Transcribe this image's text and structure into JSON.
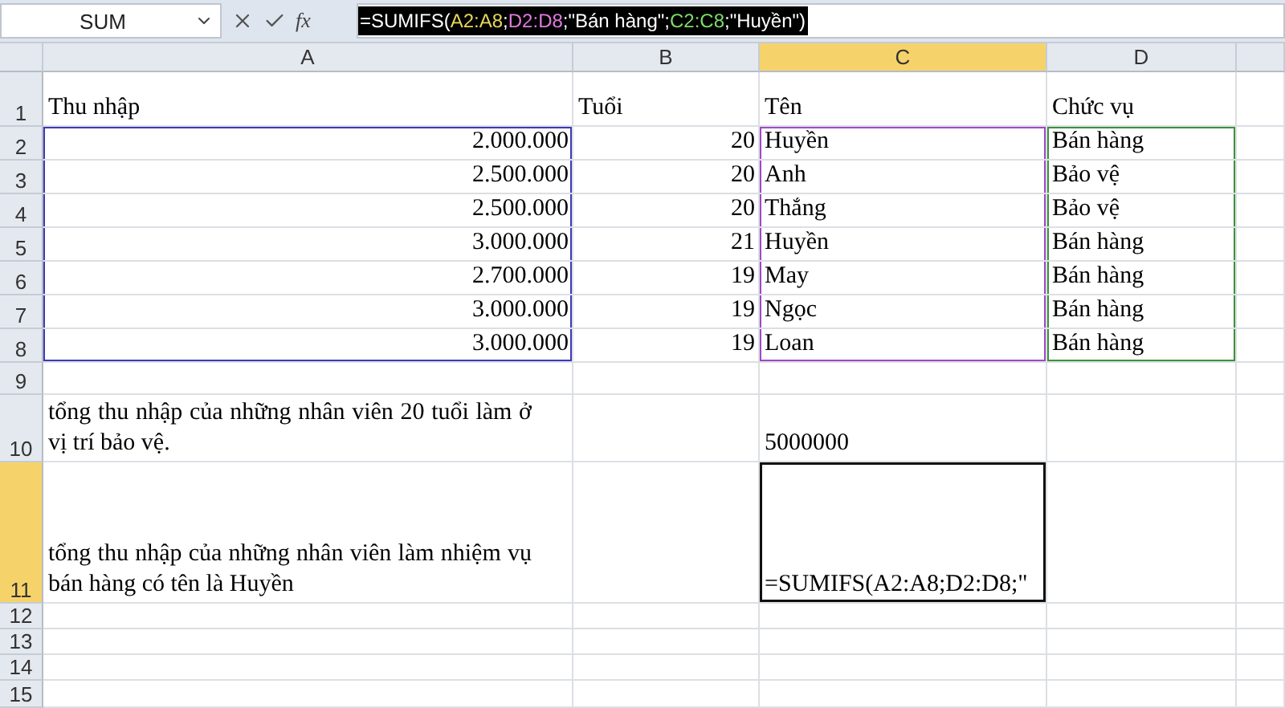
{
  "formula_bar": {
    "name_box": "SUM",
    "function_label": "fx",
    "formula": [
      {
        "text": "=SUMIFS("
      },
      {
        "text": "A2:A8",
        "color": "#e6d75a"
      },
      {
        "text": ";"
      },
      {
        "text": "D2:D8",
        "color": "#e07ae0"
      },
      {
        "text": ";\"Bán hàng\";"
      },
      {
        "text": "C2:C8",
        "color": "#7ddc6a"
      },
      {
        "text": ";\"Huyền\")"
      }
    ]
  },
  "columns": [
    {
      "label": "A",
      "selected": false
    },
    {
      "label": "B",
      "selected": false
    },
    {
      "label": "C",
      "selected": true
    },
    {
      "label": "D",
      "selected": false
    }
  ],
  "rows": [
    {
      "label": "1",
      "selected": false,
      "cells": [
        {
          "text": "Thu nhập",
          "kind": "text"
        },
        {
          "text": "Tuổi",
          "kind": "text"
        },
        {
          "text": "Tên",
          "kind": "text"
        },
        {
          "text": "Chức vụ",
          "kind": "text"
        }
      ]
    },
    {
      "label": "2",
      "selected": false,
      "cells": [
        {
          "text": "2.000.000",
          "kind": "number"
        },
        {
          "text": "20",
          "kind": "number"
        },
        {
          "text": "Huyền",
          "kind": "text"
        },
        {
          "text": "Bán hàng",
          "kind": "text"
        }
      ]
    },
    {
      "label": "3",
      "selected": false,
      "cells": [
        {
          "text": "2.500.000",
          "kind": "number"
        },
        {
          "text": "20",
          "kind": "number"
        },
        {
          "text": "Anh",
          "kind": "text"
        },
        {
          "text": "Bảo vệ",
          "kind": "text"
        }
      ]
    },
    {
      "label": "4",
      "selected": false,
      "cells": [
        {
          "text": "2.500.000",
          "kind": "number"
        },
        {
          "text": "20",
          "kind": "number"
        },
        {
          "text": "Thắng",
          "kind": "text"
        },
        {
          "text": "Bảo vệ",
          "kind": "text"
        }
      ]
    },
    {
      "label": "5",
      "selected": false,
      "cells": [
        {
          "text": "3.000.000",
          "kind": "number"
        },
        {
          "text": "21",
          "kind": "number"
        },
        {
          "text": "Huyền",
          "kind": "text"
        },
        {
          "text": "Bán hàng",
          "kind": "text"
        }
      ]
    },
    {
      "label": "6",
      "selected": false,
      "cells": [
        {
          "text": "2.700.000",
          "kind": "number"
        },
        {
          "text": "19",
          "kind": "number"
        },
        {
          "text": "May",
          "kind": "text"
        },
        {
          "text": "Bán hàng",
          "kind": "text"
        }
      ]
    },
    {
      "label": "7",
      "selected": false,
      "cells": [
        {
          "text": "3.000.000",
          "kind": "number"
        },
        {
          "text": "19",
          "kind": "number"
        },
        {
          "text": "Ngọc",
          "kind": "text"
        },
        {
          "text": "Bán hàng",
          "kind": "text"
        }
      ]
    },
    {
      "label": "8",
      "selected": false,
      "cells": [
        {
          "text": "3.000.000",
          "kind": "number"
        },
        {
          "text": "19",
          "kind": "number"
        },
        {
          "text": "Loan",
          "kind": "text"
        },
        {
          "text": "Bán hàng",
          "kind": "text"
        }
      ]
    },
    {
      "label": "9",
      "selected": false
    },
    {
      "label": "10",
      "selected": false,
      "cells": [
        {
          "text": " tổng thu nhập của những nhân viên 20 tuổi làm ở vị trí bảo vệ.",
          "kind": "wrap"
        },
        {},
        {
          "text": "5000000",
          "kind": "text"
        },
        {}
      ]
    },
    {
      "label": "11",
      "selected": true,
      "cells": [
        {
          "text": "tổng thu nhập của những nhân viên làm nhiệm vụ bán hàng có tên là Huyền",
          "kind": "wrap"
        },
        {},
        {
          "text": "=SUMIFS(A2:A8;D2:D8;\"",
          "kind": "text",
          "active": true
        },
        {}
      ]
    },
    {
      "label": "12",
      "selected": false
    },
    {
      "label": "13",
      "selected": false
    },
    {
      "label": "14",
      "selected": false
    },
    {
      "label": "15",
      "selected": false
    }
  ]
}
